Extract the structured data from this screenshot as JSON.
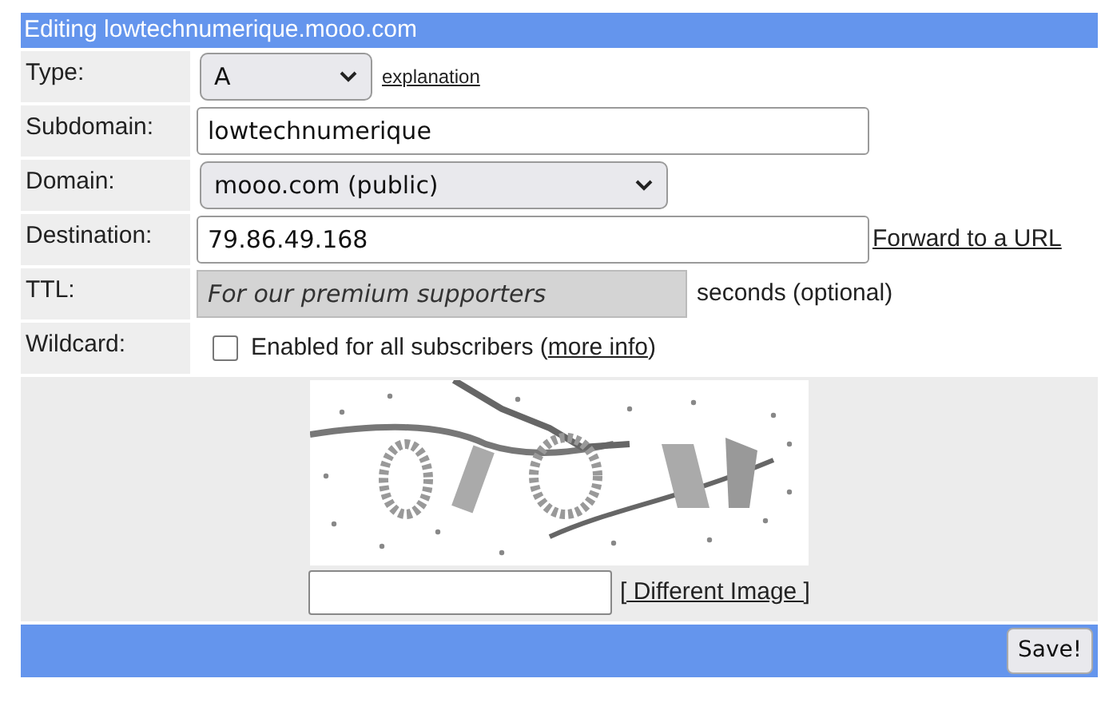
{
  "header": {
    "title": "Editing lowtechnumerique.mooo.com"
  },
  "fields": [
    {
      "kind": "select",
      "label": "Type:",
      "value": "A",
      "disabled": false,
      "link": "explanation"
    },
    {
      "kind": "text",
      "label": "Subdomain:",
      "value": "lowtechnumerique",
      "disabled": false
    },
    {
      "kind": "select",
      "label": "Domain:",
      "value": "mooo.com (public)",
      "disabled": false
    },
    {
      "kind": "text",
      "label": "Destination:",
      "value": "79.86.49.168",
      "disabled": false,
      "link": "Forward to a URL"
    },
    {
      "kind": "text",
      "label": "TTL:",
      "value": "For our premium supporters",
      "disabled": true,
      "suffix": "seconds (optional)"
    },
    {
      "kind": "checkbox",
      "label": "Wildcard:",
      "text": "Enabled for all subscribers (",
      "link": "more info",
      "text_after": ")",
      "checked": false
    }
  ],
  "captcha": {
    "kind": "picture",
    "link": "[ Different Image ]"
  },
  "save_button": "Save!"
}
